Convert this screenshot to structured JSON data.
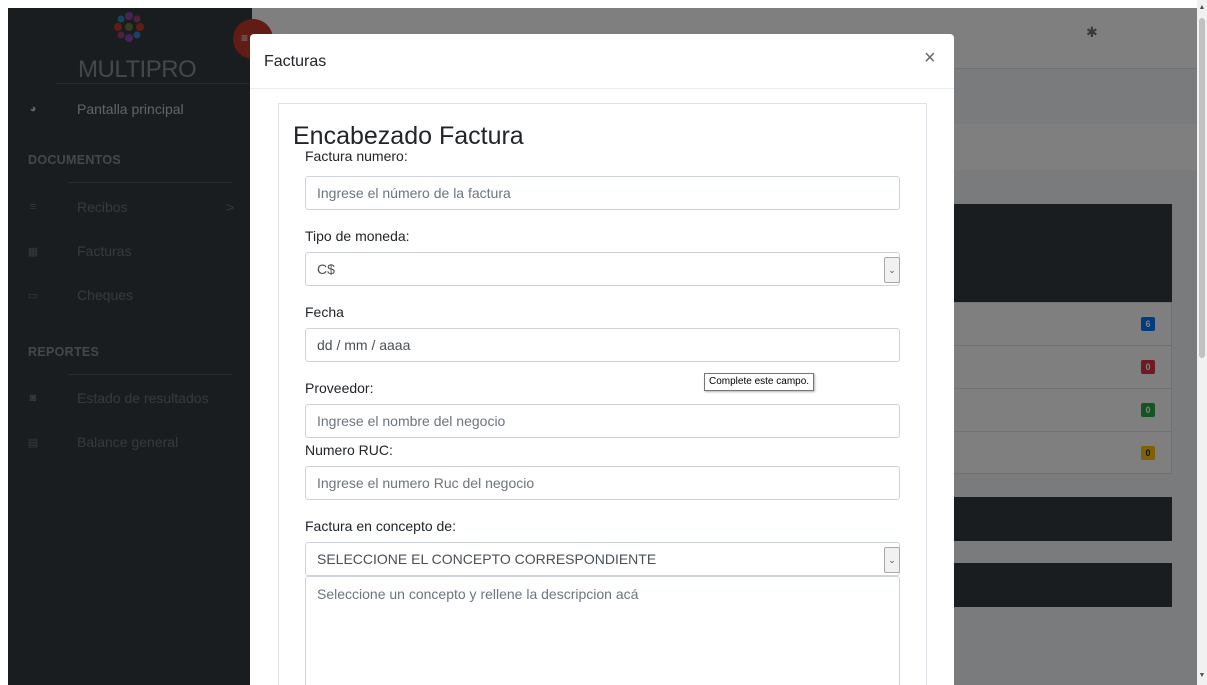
{
  "brand": {
    "name": "MULTIPRO"
  },
  "sidebar": {
    "dashboard": {
      "label": "Pantalla principal",
      "icon": "dashboard-icon"
    },
    "section_documents": "DOCUMENTOS",
    "documents": [
      {
        "label": "Recibos",
        "icon": "list-icon",
        "has_submenu": true
      },
      {
        "label": "Facturas",
        "icon": "table-icon"
      },
      {
        "label": "Cheques",
        "icon": "credit-card-icon"
      }
    ],
    "section_reports": "REPORTES",
    "reports": [
      {
        "label": "Estado de resultados",
        "icon": "money-icon"
      },
      {
        "label": "Balance general",
        "icon": "file-icon"
      }
    ],
    "submenu_chevron": ">"
  },
  "background": {
    "badges": [
      {
        "value": "6",
        "color": "#007bff"
      },
      {
        "value": "0",
        "color": "#dc3545"
      },
      {
        "value": "0",
        "color": "#28a745"
      },
      {
        "value": "0",
        "color": "#ffc107"
      }
    ]
  },
  "modal": {
    "title": "Facturas",
    "close_label": "×",
    "heading": "Encabezado Factura",
    "fields": {
      "invoice_number": {
        "label": "Factura numero:",
        "placeholder": "Ingrese el número de la factura"
      },
      "currency": {
        "label": "Tipo de moneda:",
        "value": "C$"
      },
      "date": {
        "label": "Fecha",
        "placeholder": "dd / mm / aaaa"
      },
      "provider": {
        "label": "Proveedor:",
        "placeholder": "Ingrese el nombre del negocio"
      },
      "ruc": {
        "label": "Numero RUC:",
        "placeholder": "Ingrese el numero Ruc del negocio"
      },
      "concept": {
        "label": "Factura en concepto de:",
        "value": "SELECCIONE EL CONCEPTO CORRESPONDIENTE"
      },
      "description": {
        "placeholder": "Seleccione un concepto y rellene la descripcion acá"
      }
    },
    "validation_tooltip": "Complete este campo."
  }
}
